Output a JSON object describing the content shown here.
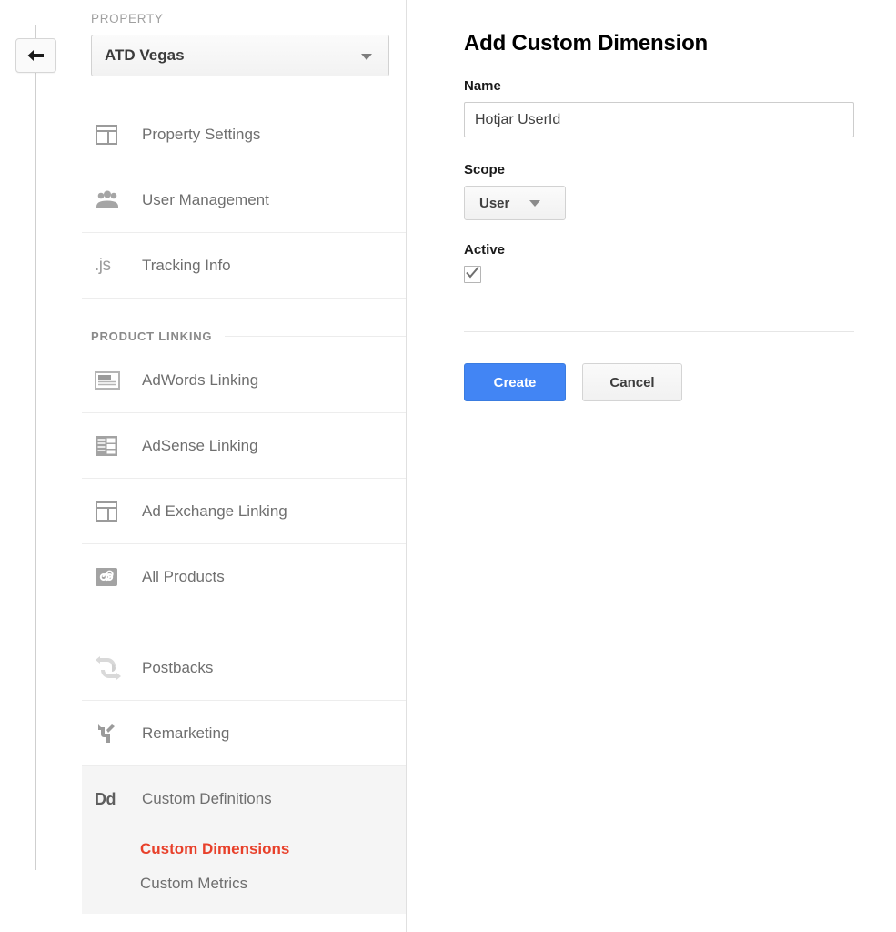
{
  "rail": {
    "back_button": {
      "icon": "back-arrow-icon",
      "label": ""
    }
  },
  "sidebar": {
    "property_section": {
      "heading": "PROPERTY",
      "selected_property": "ATD Vegas",
      "caret_icon": "chevron-down-icon"
    },
    "property_items": [
      {
        "label": "Property Settings",
        "icon": "property-settings-icon"
      },
      {
        "label": "User Management",
        "icon": "user-management-icon"
      },
      {
        "label": "Tracking Info",
        "icon": "js-icon"
      }
    ],
    "product_linking_section": {
      "heading": "PRODUCT LINKING"
    },
    "product_linking_items": [
      {
        "label": "AdWords Linking",
        "icon": "adwords-linking-icon"
      },
      {
        "label": "AdSense Linking",
        "icon": "adsense-linking-icon"
      },
      {
        "label": "Ad Exchange Linking",
        "icon": "ad-exchange-linking-icon"
      },
      {
        "label": "All Products",
        "icon": "all-products-icon"
      }
    ],
    "other_items": [
      {
        "label": "Postbacks",
        "icon": "postbacks-icon"
      },
      {
        "label": "Remarketing",
        "icon": "remarketing-icon"
      }
    ],
    "custom_definitions": {
      "label": "Custom Definitions",
      "icon": "dd-icon",
      "icon_text": "Dd",
      "subitems": [
        {
          "label": "Custom Dimensions",
          "active": true
        },
        {
          "label": "Custom Metrics",
          "active": false
        }
      ]
    },
    "accent_color": "#e8412b"
  },
  "main": {
    "title": "Add Custom Dimension",
    "name_field": {
      "label": "Name",
      "value": "Hotjar UserId",
      "placeholder": ""
    },
    "scope_field": {
      "label": "Scope",
      "value": "User",
      "caret_icon": "chevron-down-icon"
    },
    "active_field": {
      "label": "Active",
      "checked": true,
      "check_icon": "checkmark-icon"
    },
    "buttons": {
      "create": "Create",
      "cancel": "Cancel"
    },
    "primary_color": "#4285f4"
  }
}
